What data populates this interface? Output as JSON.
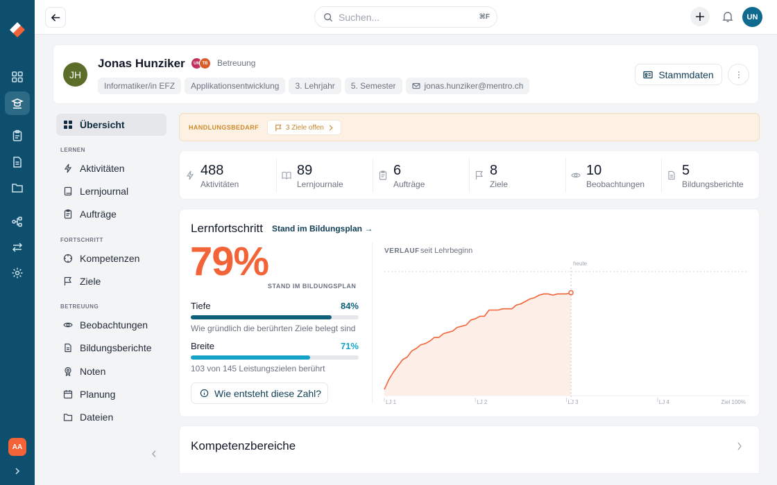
{
  "search": {
    "placeholder": "Suchen...",
    "shortcut": "⌘F"
  },
  "user": {
    "initials": "UN"
  },
  "rail": {
    "bottom_avatar": "AA"
  },
  "profile": {
    "initials": "JH",
    "name": "Jonas Hunziker",
    "mini_avatars": [
      "UN",
      "TB"
    ],
    "role_label": "Betreuung",
    "chips": [
      "Informatiker/in EFZ",
      "Applikationsentwicklung",
      "3. Lehrjahr",
      "5. Semester"
    ],
    "email": "jonas.hunziker@mentro.ch",
    "stammdaten_label": "Stammdaten"
  },
  "sidebar": {
    "overview": "Übersicht",
    "section_lernen": "LERNEN",
    "aktivitaeten": "Aktivitäten",
    "lernjournal": "Lernjournal",
    "auftraege": "Aufträge",
    "section_fortschritt": "FORTSCHRITT",
    "kompetenzen": "Kompetenzen",
    "ziele": "Ziele",
    "section_betreuung": "BETREUUNG",
    "beobachtungen": "Beobachtungen",
    "bildungsberichte": "Bildungsberichte",
    "noten": "Noten",
    "planung": "Planung",
    "dateien": "Dateien"
  },
  "alert": {
    "label": "HANDLUNGSBEDARF",
    "pill": "3 Ziele offen"
  },
  "stats": [
    {
      "value": "488",
      "label": "Aktivitäten",
      "icon": "bolt-icon"
    },
    {
      "value": "89",
      "label": "Lernjournale",
      "icon": "book-icon"
    },
    {
      "value": "6",
      "label": "Aufträge",
      "icon": "clipboard-icon"
    },
    {
      "value": "8",
      "label": "Ziele",
      "icon": "flag-icon"
    },
    {
      "value": "10",
      "label": "Beobachtungen",
      "icon": "eye-icon"
    },
    {
      "value": "5",
      "label": "Bildungsberichte",
      "icon": "document-icon"
    }
  ],
  "progress": {
    "title": "Lernfortschritt",
    "link": "Stand im Bildungsplan →",
    "percent": "79%",
    "percent_caption": "STAND IM BILDUNGSPLAN",
    "tiefe": {
      "label": "Tiefe",
      "value": "84%",
      "fraction": 0.84,
      "desc": "Wie gründlich die berührten Ziele belegt sind",
      "color": "#0e5f7a"
    },
    "breite": {
      "label": "Breite",
      "value": "71%",
      "fraction": 0.71,
      "desc": "103 von 145 Leistungszielen berührt",
      "color": "#14a3c7"
    },
    "info_button": "Wie entsteht diese Zahl?"
  },
  "chart_data": {
    "type": "area",
    "title": "VERLAUF",
    "subtitle": "seit Lehrbeginn",
    "marker_label": "heute",
    "x_ticks": [
      "LJ 1",
      "LJ 2",
      "LJ 3",
      "LJ 4",
      "Ziel 100%"
    ],
    "xlim": [
      0,
      4
    ],
    "ylim": [
      0,
      100
    ],
    "line_color": "#f26437",
    "fill_color": "#fdeee8",
    "marker_x": 2.05,
    "x": [
      0,
      0.05,
      0.1,
      0.15,
      0.2,
      0.25,
      0.3,
      0.35,
      0.4,
      0.45,
      0.5,
      0.55,
      0.6,
      0.65,
      0.7,
      0.75,
      0.8,
      0.85,
      0.9,
      0.95,
      1.0,
      1.05,
      1.1,
      1.15,
      1.2,
      1.25,
      1.3,
      1.35,
      1.4,
      1.45,
      1.5,
      1.55,
      1.6,
      1.65,
      1.7,
      1.75,
      1.8,
      1.85,
      1.9,
      1.95,
      2.0,
      2.05
    ],
    "y": [
      5,
      13,
      19,
      24,
      29,
      31,
      36,
      38,
      41,
      42,
      44,
      47,
      47,
      50,
      51,
      52,
      55,
      56,
      57,
      61,
      62,
      64,
      64,
      69,
      69,
      69,
      70,
      70,
      70,
      73,
      74,
      76,
      78,
      79,
      81,
      82,
      82,
      81,
      82,
      82,
      82,
      83
    ]
  },
  "kompetenz": {
    "title": "Kompetenzbereiche"
  }
}
